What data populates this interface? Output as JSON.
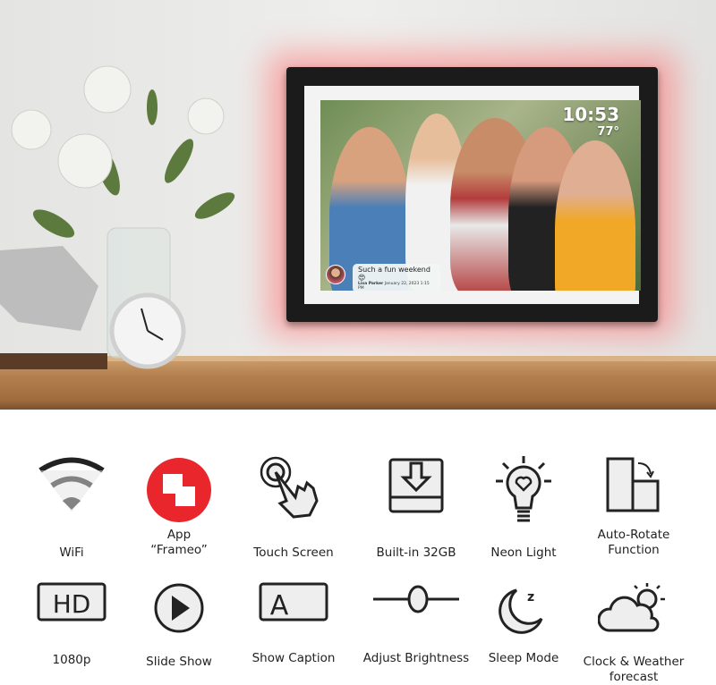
{
  "frame_display": {
    "time": "10:53",
    "temperature": "77°",
    "caption_text": "Such a fun weekend 😍",
    "caption_author": "Lisa Parker",
    "caption_date": "January 22, 2023 1:15 PM"
  },
  "features": [
    {
      "label": "WiFi",
      "icon": "wifi-icon"
    },
    {
      "label": "App\n“Frameo”",
      "icon": "frameo-app-icon"
    },
    {
      "label": "Touch Screen",
      "icon": "touch-icon"
    },
    {
      "label": "Built-in 32GB",
      "icon": "storage-icon"
    },
    {
      "label": "Neon Light",
      "icon": "bulb-icon"
    },
    {
      "label": "Auto-Rotate\nFunction",
      "icon": "rotate-icon"
    },
    {
      "label": "1080p",
      "icon": "hd-icon"
    },
    {
      "label": "Slide Show",
      "icon": "play-icon"
    },
    {
      "label": "Show Caption",
      "icon": "caption-icon"
    },
    {
      "label": "Adjust Brightness",
      "icon": "slider-icon"
    },
    {
      "label": "Sleep Mode",
      "icon": "moon-icon"
    },
    {
      "label": "Clock & Weather\nforecast",
      "icon": "weather-icon"
    }
  ],
  "colors": {
    "frameo_red": "#e8262b",
    "glow": "#ff6a6a",
    "frame": "#1b1b1b"
  }
}
